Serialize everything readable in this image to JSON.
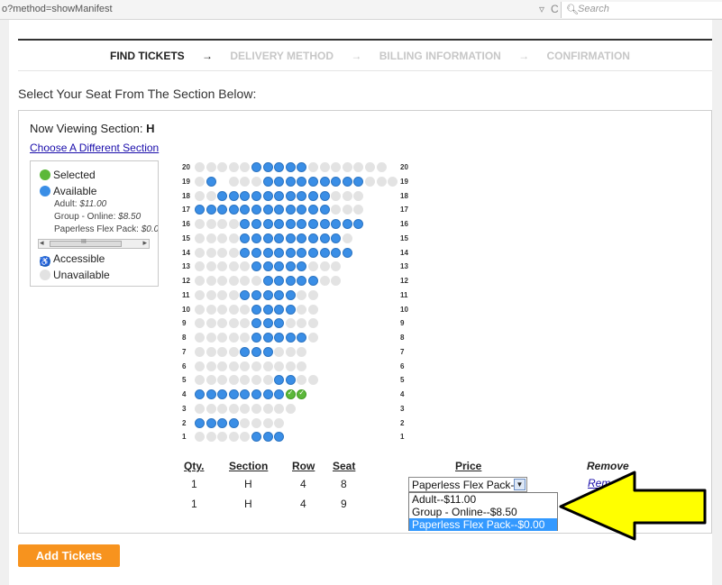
{
  "browser": {
    "url": "o?method=showManifest",
    "search_placeholder": "Search"
  },
  "steps": [
    {
      "label": "FIND TICKETS",
      "state": "active"
    },
    {
      "label": "DELIVERY METHOD",
      "state": "inactive"
    },
    {
      "label": "BILLING INFORMATION",
      "state": "inactive"
    },
    {
      "label": "CONFIRMATION",
      "state": "inactive"
    }
  ],
  "step_arrow": "→",
  "heading": "Select Your Seat From The Section Below:",
  "viewing": {
    "label": "Now Viewing Section:",
    "section": "H",
    "change_link": "Choose A Different Section"
  },
  "legend": {
    "selected": "Selected",
    "available": "Available",
    "prices": [
      {
        "label": "Adult:",
        "value": "$11.00"
      },
      {
        "label": "Group - Online:",
        "value": "$8.50"
      },
      {
        "label": "Paperless Flex Pack:",
        "value": "$0.0"
      }
    ],
    "scroll_glyph": "III",
    "accessible": "Accessible",
    "unavailable": "Unavailable"
  },
  "seat_rows": [
    {
      "row": "20",
      "seats": "uuuuuaaaaauuuuuuu"
    },
    {
      "row": "19",
      "seats": "uaxuuuaaaaaaaaauuu"
    },
    {
      "row": "18",
      "seats": "uuaaaaaaaaaauuu"
    },
    {
      "row": "17",
      "seats": "aaaaaaaaaaaauuu"
    },
    {
      "row": "16",
      "seats": "uuuuaaaaaaaaaaa"
    },
    {
      "row": "15",
      "seats": "uuuuaaaaaaaaau"
    },
    {
      "row": "14",
      "seats": "uuuuaaaaaaaaaa"
    },
    {
      "row": "13",
      "seats": "uuuuuaaaaauuu"
    },
    {
      "row": "12",
      "seats": "uuuuuuaaaaauu"
    },
    {
      "row": "11",
      "seats": "uuuuaaaaauu"
    },
    {
      "row": "10",
      "seats": "uuuuuaaaauu"
    },
    {
      "row": "9",
      "seats": "uuuuuaaauuu"
    },
    {
      "row": "8",
      "seats": "uuuuuaaaaau"
    },
    {
      "row": "7",
      "seats": "uuuuaaauuu"
    },
    {
      "row": "6",
      "seats": "uuuuuuuuuu"
    },
    {
      "row": "5",
      "seats": "uuuuuuuaauu"
    },
    {
      "row": "4",
      "seats": "aaaaaaaass"
    },
    {
      "row": "3",
      "seats": "uuuuuuuuu"
    },
    {
      "row": "2",
      "seats": "aaaauuuu"
    },
    {
      "row": "1",
      "seats": "uuuuuaaa"
    }
  ],
  "tickets": {
    "headers": {
      "qty": "Qty.",
      "section": "Section",
      "row": "Row",
      "seat": "Seat",
      "price": "Price",
      "remove": "Remove"
    },
    "rows": [
      {
        "qty": "1",
        "section": "H",
        "row": "4",
        "seat": "8"
      },
      {
        "qty": "1",
        "section": "H",
        "row": "4",
        "seat": "9"
      }
    ],
    "price_selected": "Paperless Flex Pack--",
    "price_options": [
      "Adult--$11.00",
      "Group - Online--$8.50",
      "Paperless Flex Pack--$0.00"
    ],
    "highlighted_option": 2,
    "remove_label": "Remo"
  },
  "add_button": "Add Tickets",
  "colors": {
    "available": "#3a8ee6",
    "selected": "#5cb83a",
    "unavailable": "#e3e3e3",
    "add_button": "#f7931e",
    "annotation_arrow": "#ffff00"
  }
}
